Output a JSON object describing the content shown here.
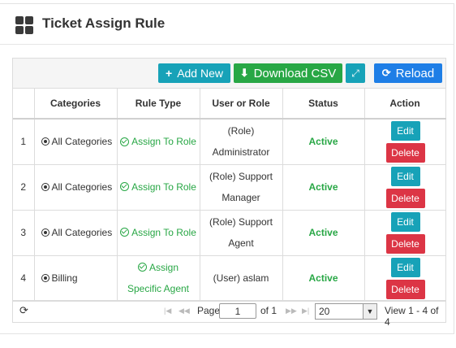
{
  "header": {
    "title": "Ticket Assign Rule",
    "icon": "grid-icon"
  },
  "toolbar": {
    "add_new": "Add New",
    "download_csv": "Download CSV",
    "reload": "Reload"
  },
  "table": {
    "columns": [
      "",
      "Categories",
      "Rule Type",
      "User or Role",
      "Status",
      "Action"
    ],
    "rows": [
      {
        "num": "1",
        "category": "All Categories",
        "rule_type": "Assign To Role",
        "user_line1": "(Role)",
        "user_line2": "Administrator",
        "status": "Active"
      },
      {
        "num": "2",
        "category": "All Categories",
        "rule_type": "Assign To Role",
        "user_line1": "(Role) Support",
        "user_line2": "Manager",
        "status": "Active"
      },
      {
        "num": "3",
        "category": "All Categories",
        "rule_type": "Assign To Role",
        "user_line1": "(Role) Support",
        "user_line2": "Agent",
        "status": "Active"
      },
      {
        "num": "4",
        "category": "Billing",
        "rule_type_line1": "Assign",
        "rule_type_line2": "Specific Agent",
        "user_line1": "(User) aslam",
        "status": "Active"
      }
    ],
    "edit_label": "Edit",
    "delete_label": "Delete"
  },
  "pager": {
    "page_label": "Page",
    "page_value": "1",
    "of_label": "of 1",
    "rows_per_page": "20",
    "view_text": "View 1 - 4 of 4"
  },
  "colors": {
    "teal": "#17a2b8",
    "green": "#28a745",
    "blue": "#1e7ee6",
    "red": "#dc3545"
  }
}
